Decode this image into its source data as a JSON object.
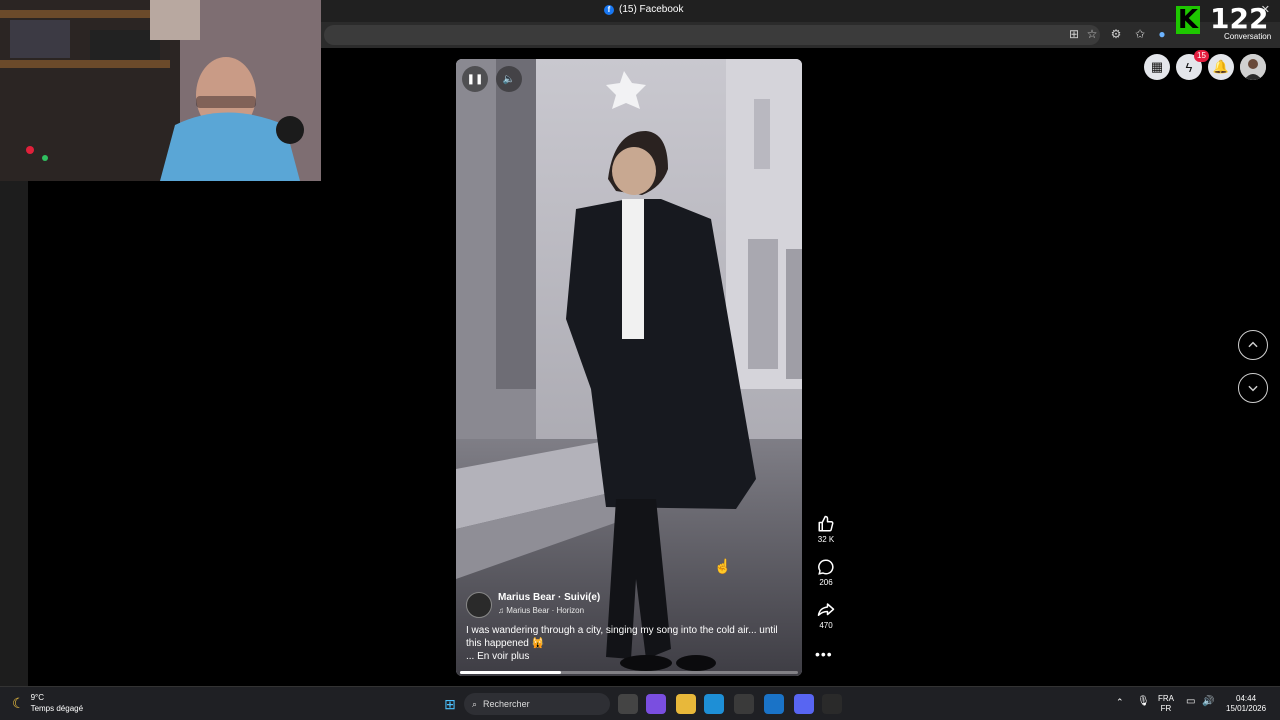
{
  "browser": {
    "tab_title": "(15) Facebook",
    "favicon": "facebook-icon",
    "close_glyph": "✕"
  },
  "overlay": {
    "score_value": "122",
    "score_letter": "K",
    "score_label": "Conversation"
  },
  "facebook": {
    "notifications_badge": "15",
    "accent": "#1877f2"
  },
  "reel": {
    "author_name": "Marius Bear · Suivi(e)",
    "music": "♫ Marius Bear · Horizon",
    "caption": "I was wandering through a city, singing my song into the cold air... until this happened 🙀",
    "see_more": "... En voir plus",
    "progress": 0.3,
    "likes": "32 K",
    "comments": "206",
    "shares": "470"
  },
  "taskbar": {
    "temperature": "9°C",
    "weather": "Temps dégagé",
    "search_placeholder": "Rechercher",
    "language_top": "FRA",
    "language_bottom": "FR",
    "time": "04:44",
    "date": "15/01/2026"
  }
}
